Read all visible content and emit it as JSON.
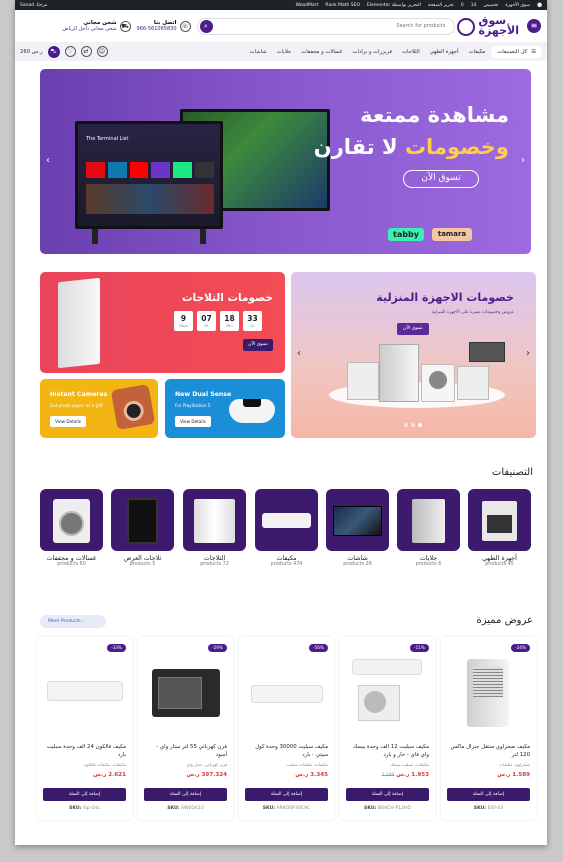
{
  "wpbar": {
    "items": [
      "سوق الأجهزة",
      "تخصيص",
      "14",
      "0",
      "تحرير الصفحة",
      "التحرير بواسطة Elementor",
      "Rank Math SEO",
      "WoodMart"
    ],
    "user": "مرحبًا، Sanad"
  },
  "header": {
    "logo_line1": "سوق",
    "logo_line2": "الأجهزة",
    "search_placeholder": "Search for products",
    "call_label": "اتصل بنا",
    "phone": "966-561065830",
    "ship_title": "شحن مجاني",
    "ship_sub": "شحن مجاني داخل الرياض"
  },
  "nav": {
    "categories_label": "كل التصنيفات",
    "links": [
      "مكيفات",
      "أجهزة الطهي",
      "الثلاجات",
      "فريزرات و برادات",
      "غسالات و مجففات",
      "جلايات",
      "شاشات"
    ],
    "cart_total": "260 ر.س"
  },
  "hero": {
    "line1": "مشاهدة ممتعة",
    "line2a": "وخصومات",
    "line2b": "لا تقارن",
    "cta": "تسوق الآن",
    "pay1": "tabby",
    "pay2": "tamara",
    "tv_text": "The Terminal List"
  },
  "promo_fridge": {
    "title": "خصومات الثلاجات",
    "countdown": [
      {
        "v": "9",
        "u": "Days"
      },
      {
        "v": "07",
        "u": "Hr"
      },
      {
        "v": "18",
        "u": "Min"
      },
      {
        "v": "33",
        "u": "Sc"
      }
    ],
    "btn": "تسوق الآن"
  },
  "promo_home": {
    "title": "خصومات الاجهزة المنزلية",
    "sub": "عروض وخصومات مميزة على الاجهزة المنزلية",
    "btn": "تسوق الآن"
  },
  "promo_cam": {
    "title": "Instant Cameras",
    "sub": "Get photo paper as a gift",
    "btn": "View Details"
  },
  "promo_ds": {
    "title": "New Dual Sense",
    "sub": "For PlayStation 5",
    "btn": "View Details"
  },
  "categories": {
    "title": "التصنيفات",
    "items": [
      {
        "name": "أجهزة الطهي",
        "count": "products 45"
      },
      {
        "name": "جلايات",
        "count": "products 6"
      },
      {
        "name": "شاشات",
        "count": "products 26"
      },
      {
        "name": "مكيفات",
        "count": "products 474"
      },
      {
        "name": "الثلاجات",
        "count": "products 72"
      },
      {
        "name": "ثلاجات العرض",
        "count": "products 5"
      },
      {
        "name": "غسالات و مجففات",
        "count": "products 60"
      }
    ]
  },
  "featured": {
    "title": "عروض مميزة",
    "more": "More Products",
    "add_label": "إضافة إلى السلة",
    "sku_label": "SKU:",
    "products": [
      {
        "badge": "-24%",
        "name": "مكيف صحراوي متنقل جنرال ماكس 120 لتر",
        "cat": "صحراوي، مكيفات",
        "price": "1.589 ر.س",
        "old": "",
        "sku": "ESY-03"
      },
      {
        "badge": "-11%",
        "name": "مكيف سبليت 12 الف وحدة بيسك واي فاي - حار و بارد",
        "cat": "مكيفات، سبليت بيسك",
        "price": "1.953 ر.س",
        "old": "2.199",
        "sku": "BSACH-P12HD"
      },
      {
        "badge": "-56%",
        "name": "مكيف سبليت 30000 وحدة كول سيتي - بارد",
        "cat": "مكيفات، مكيفات سبليت",
        "price": "3.345 ر.س",
        "old": "",
        "sku": "ARKOSP30CAC"
      },
      {
        "badge": "-29%",
        "name": "فرن كهربائي 55 لتر ستار واي - أسود",
        "cat": "فرن كهربائي، ستار واي",
        "price": "397.324 ر.س",
        "old": "",
        "sku": "SWEO410"
      },
      {
        "badge": "-33%",
        "name": "مكيف فالكون 24 الف وحدة سبليت بارد",
        "cat": "مكيفات، مكيفات فالكون",
        "price": "2.621 ر.س",
        "old": "",
        "sku": "fsp-24c"
      }
    ]
  }
}
